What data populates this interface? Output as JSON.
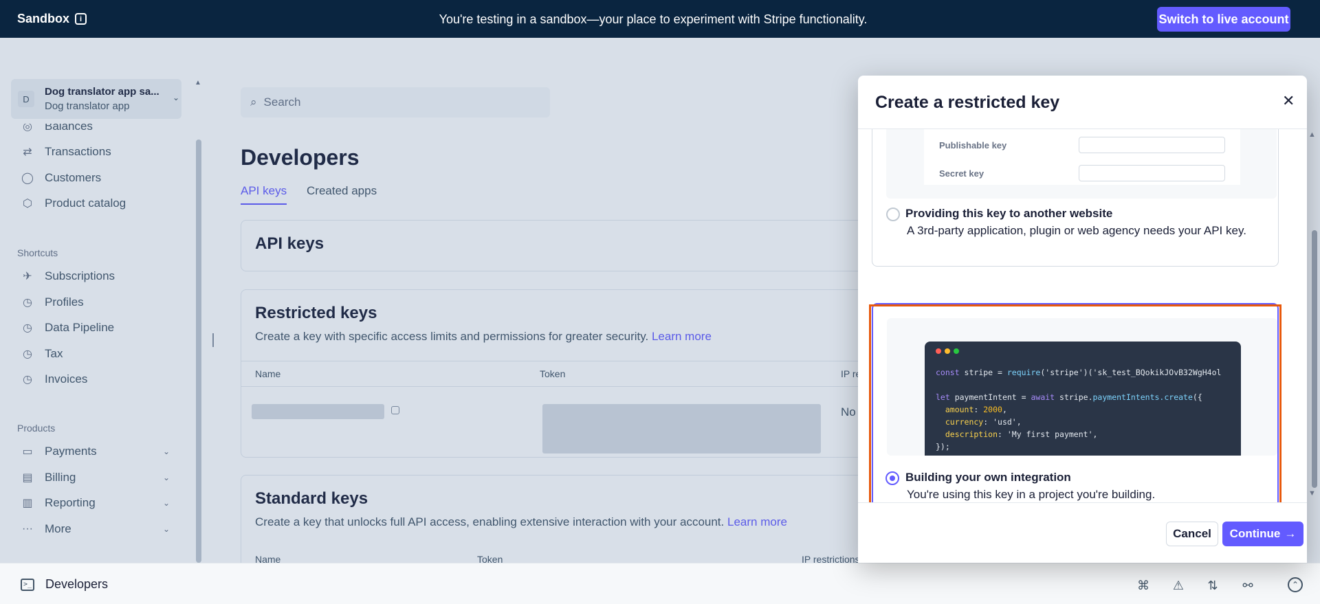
{
  "banner": {
    "sandbox_label": "Sandbox",
    "message": "You're testing in a sandbox—your place to experiment with Stripe functionality.",
    "live_button": "Switch to live account"
  },
  "sidebar": {
    "account_name": "Dog translator app sa...",
    "account_sub": "Dog translator app",
    "account_initial": "D",
    "items_top": [
      {
        "label": "Balances",
        "icon": "balances-icon"
      },
      {
        "label": "Transactions",
        "icon": "transactions-icon"
      },
      {
        "label": "Customers",
        "icon": "customers-icon"
      },
      {
        "label": "Product catalog",
        "icon": "product-catalog-icon"
      }
    ],
    "shortcuts_label": "Shortcuts",
    "shortcuts": [
      {
        "label": "Subscriptions"
      },
      {
        "label": "Profiles"
      },
      {
        "label": "Data Pipeline"
      },
      {
        "label": "Tax"
      },
      {
        "label": "Invoices"
      }
    ],
    "products_label": "Products",
    "products": [
      {
        "label": "Payments"
      },
      {
        "label": "Billing"
      },
      {
        "label": "Reporting"
      },
      {
        "label": "More"
      }
    ]
  },
  "main": {
    "search_placeholder": "Search",
    "title": "Developers",
    "tabs": [
      {
        "label": "API keys"
      },
      {
        "label": "Created apps"
      }
    ],
    "api_keys_heading": "API keys",
    "restricted": {
      "heading": "Restricted keys",
      "desc": "Create a key with specific access limits and permissions for greater security.",
      "link": "Learn more",
      "col_name": "Name",
      "col_token": "Token",
      "col_ip": "IP re",
      "row_ip": "No"
    },
    "standard": {
      "heading": "Standard keys",
      "desc": "Create a key that unlocks full API access, enabling extensive interaction with your account.",
      "link": "Learn more",
      "col_name": "Name",
      "col_token": "Token",
      "col_ip": "IP restrictions"
    }
  },
  "modal": {
    "title": "Create a restricted key",
    "preview_publishable": "Publishable key",
    "preview_secret": "Secret key",
    "option1_title": "Providing this key to another website",
    "option1_desc": "A 3rd-party application, plugin or web agency needs your API key.",
    "option2_title": "Building your own integration",
    "option2_desc": "You're using this key in a project you're building.",
    "code": {
      "l1_kw": "const",
      "l1_a": " stripe = ",
      "l1_fn": "require",
      "l1_b": "('stripe')('sk_test_BQokikJOvB32WgH4ol",
      "l2_kw": "let",
      "l2_a": " paymentIntent = ",
      "l2_kw2": "await",
      "l2_b": " stripe.",
      "l2_fn": "paymentIntents.create",
      "l2_c": "({",
      "l3_k": "  amount",
      "l3_v": " 2000",
      "l4_k": "  currency",
      "l4_v": " 'usd'",
      "l5_k": "  description",
      "l5_v": " 'My first payment'",
      "l6": "});"
    },
    "cancel": "Cancel",
    "continue": "Continue"
  },
  "bottombar": {
    "label": "Developers"
  },
  "colors": {
    "accent": "#635bff",
    "banner": "#0a2540",
    "highlight": "#e8590c"
  }
}
